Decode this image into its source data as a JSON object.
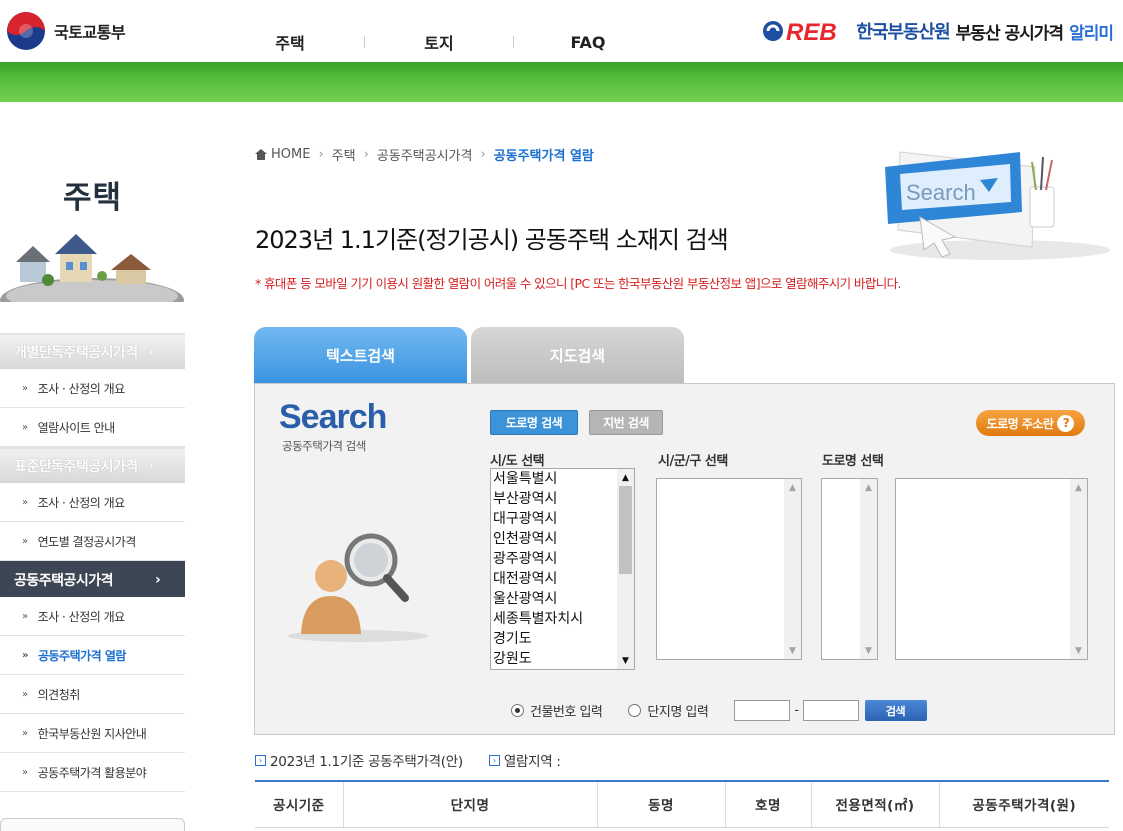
{
  "header": {
    "ministry_name": "국토교통부",
    "nav": [
      "주택",
      "토지",
      "FAQ"
    ],
    "reb_mark": "REB",
    "reb_org": "한국부동산원",
    "service_title": "부동산 공시가격",
    "service_title_accent": "알리미"
  },
  "sidebar": {
    "title": "주택",
    "categories": [
      {
        "label": "개별단독주택공시가격",
        "arrow": "›",
        "items": [
          "조사 · 산정의 개요",
          "열람사이트 안내"
        ]
      },
      {
        "label": "표준단독주택공시가격",
        "arrow": "›",
        "items": [
          "조사 · 산정의 개요",
          "연도별 결정공시가격"
        ]
      },
      {
        "label": "공동주택공시가격",
        "arrow": "›",
        "items": [
          "조사 · 산정의 개요",
          "공동주택가격 열람",
          "의견청취",
          "한국부동산원 지사안내",
          "공동주택가격 활용분야"
        ]
      }
    ],
    "bullet": "»"
  },
  "breadcrumb": [
    "HOME",
    "주택",
    "공동주택공시가격",
    "공동주택가격 열람"
  ],
  "breadcrumb_sep": "›",
  "page_title": "2023년 1.1기준(정기공시) 공동주택 소재지 검색",
  "notice": "* 휴대폰 등 모바일 기기 이용시 원활한 열람이 어려울 수 있으니 [PC 또는 한국부동산원 부동산정보 앱]으로 열람해주시기 바랍니다.",
  "hero_search_text": "Search",
  "tabs": [
    "텍스트검색",
    "지도검색"
  ],
  "search": {
    "logo": "Search",
    "logo_sub": "공동주택가격 검색",
    "btn_road": "도로명 검색",
    "btn_jibun": "지번 검색",
    "btn_addr": "도로명 주소란",
    "help": "?",
    "label_sido": "시/도 선택",
    "label_sigungu": "시/군/구 선택",
    "label_road": "도로명 선택",
    "sido_options": [
      "서울특별시",
      "부산광역시",
      "대구광역시",
      "인천광역시",
      "광주광역시",
      "대전광역시",
      "울산광역시",
      "세종특별자치시",
      "경기도",
      "강원도"
    ],
    "radio_building": "건물번호 입력",
    "radio_complex": "단지명 입력",
    "dash": "-",
    "btn_search": "검색"
  },
  "result": {
    "caption": "2023년 1.1기준 공동주택가격(안)",
    "region_label": "열람지역 :",
    "columns": [
      "공시기준",
      "단지명",
      "동명",
      "호명",
      "전용면적(㎡)",
      "공동주택가격(원)"
    ]
  },
  "colors": {
    "accent": "#2a6fd6",
    "green": "#55bd3c",
    "notice": "#d42020",
    "sidebar_active": "#3d4654"
  }
}
